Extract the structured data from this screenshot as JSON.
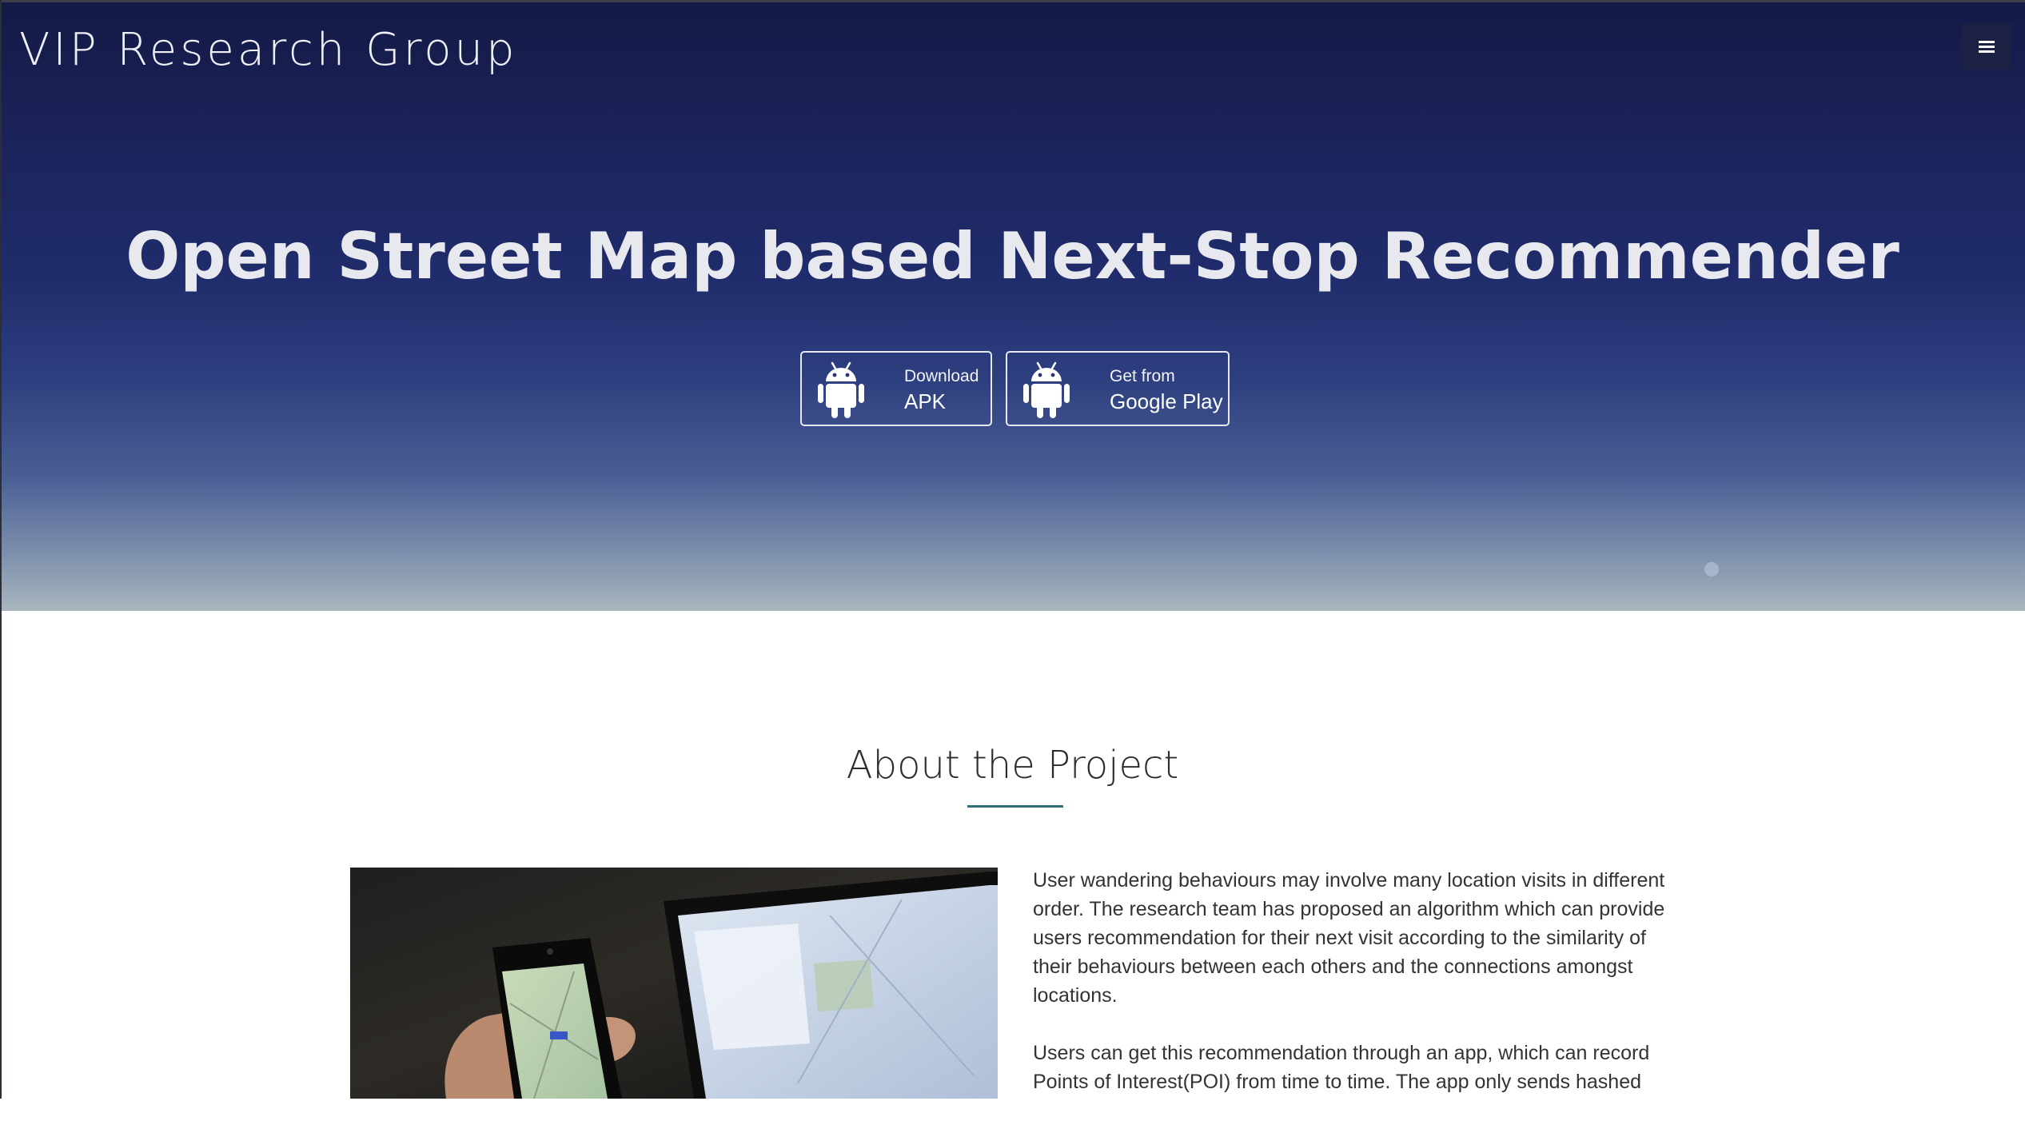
{
  "navbar": {
    "brand": "VIP Research Group",
    "menu_icon": "hamburger-menu-icon"
  },
  "hero": {
    "title": "Open Street Map based Next-Stop Recommender",
    "buttons": [
      {
        "icon": "android-icon",
        "small_label": "Download",
        "big_label": "APK"
      },
      {
        "icon": "android-icon",
        "small_label": "Get from",
        "big_label": "Google Play"
      }
    ]
  },
  "about": {
    "title": "About the Project",
    "paragraphs": [
      "User wandering behaviours may involve many location visits in different order. The research team has proposed an algorithm which can provide users recommendation for their next visit according to the similarity of their behaviours between each others and the connections amongst locations.",
      "Users can get this recommendation through an app, which can record Points of Interest(POI) from time to time. The app only sends hashed"
    ]
  }
}
